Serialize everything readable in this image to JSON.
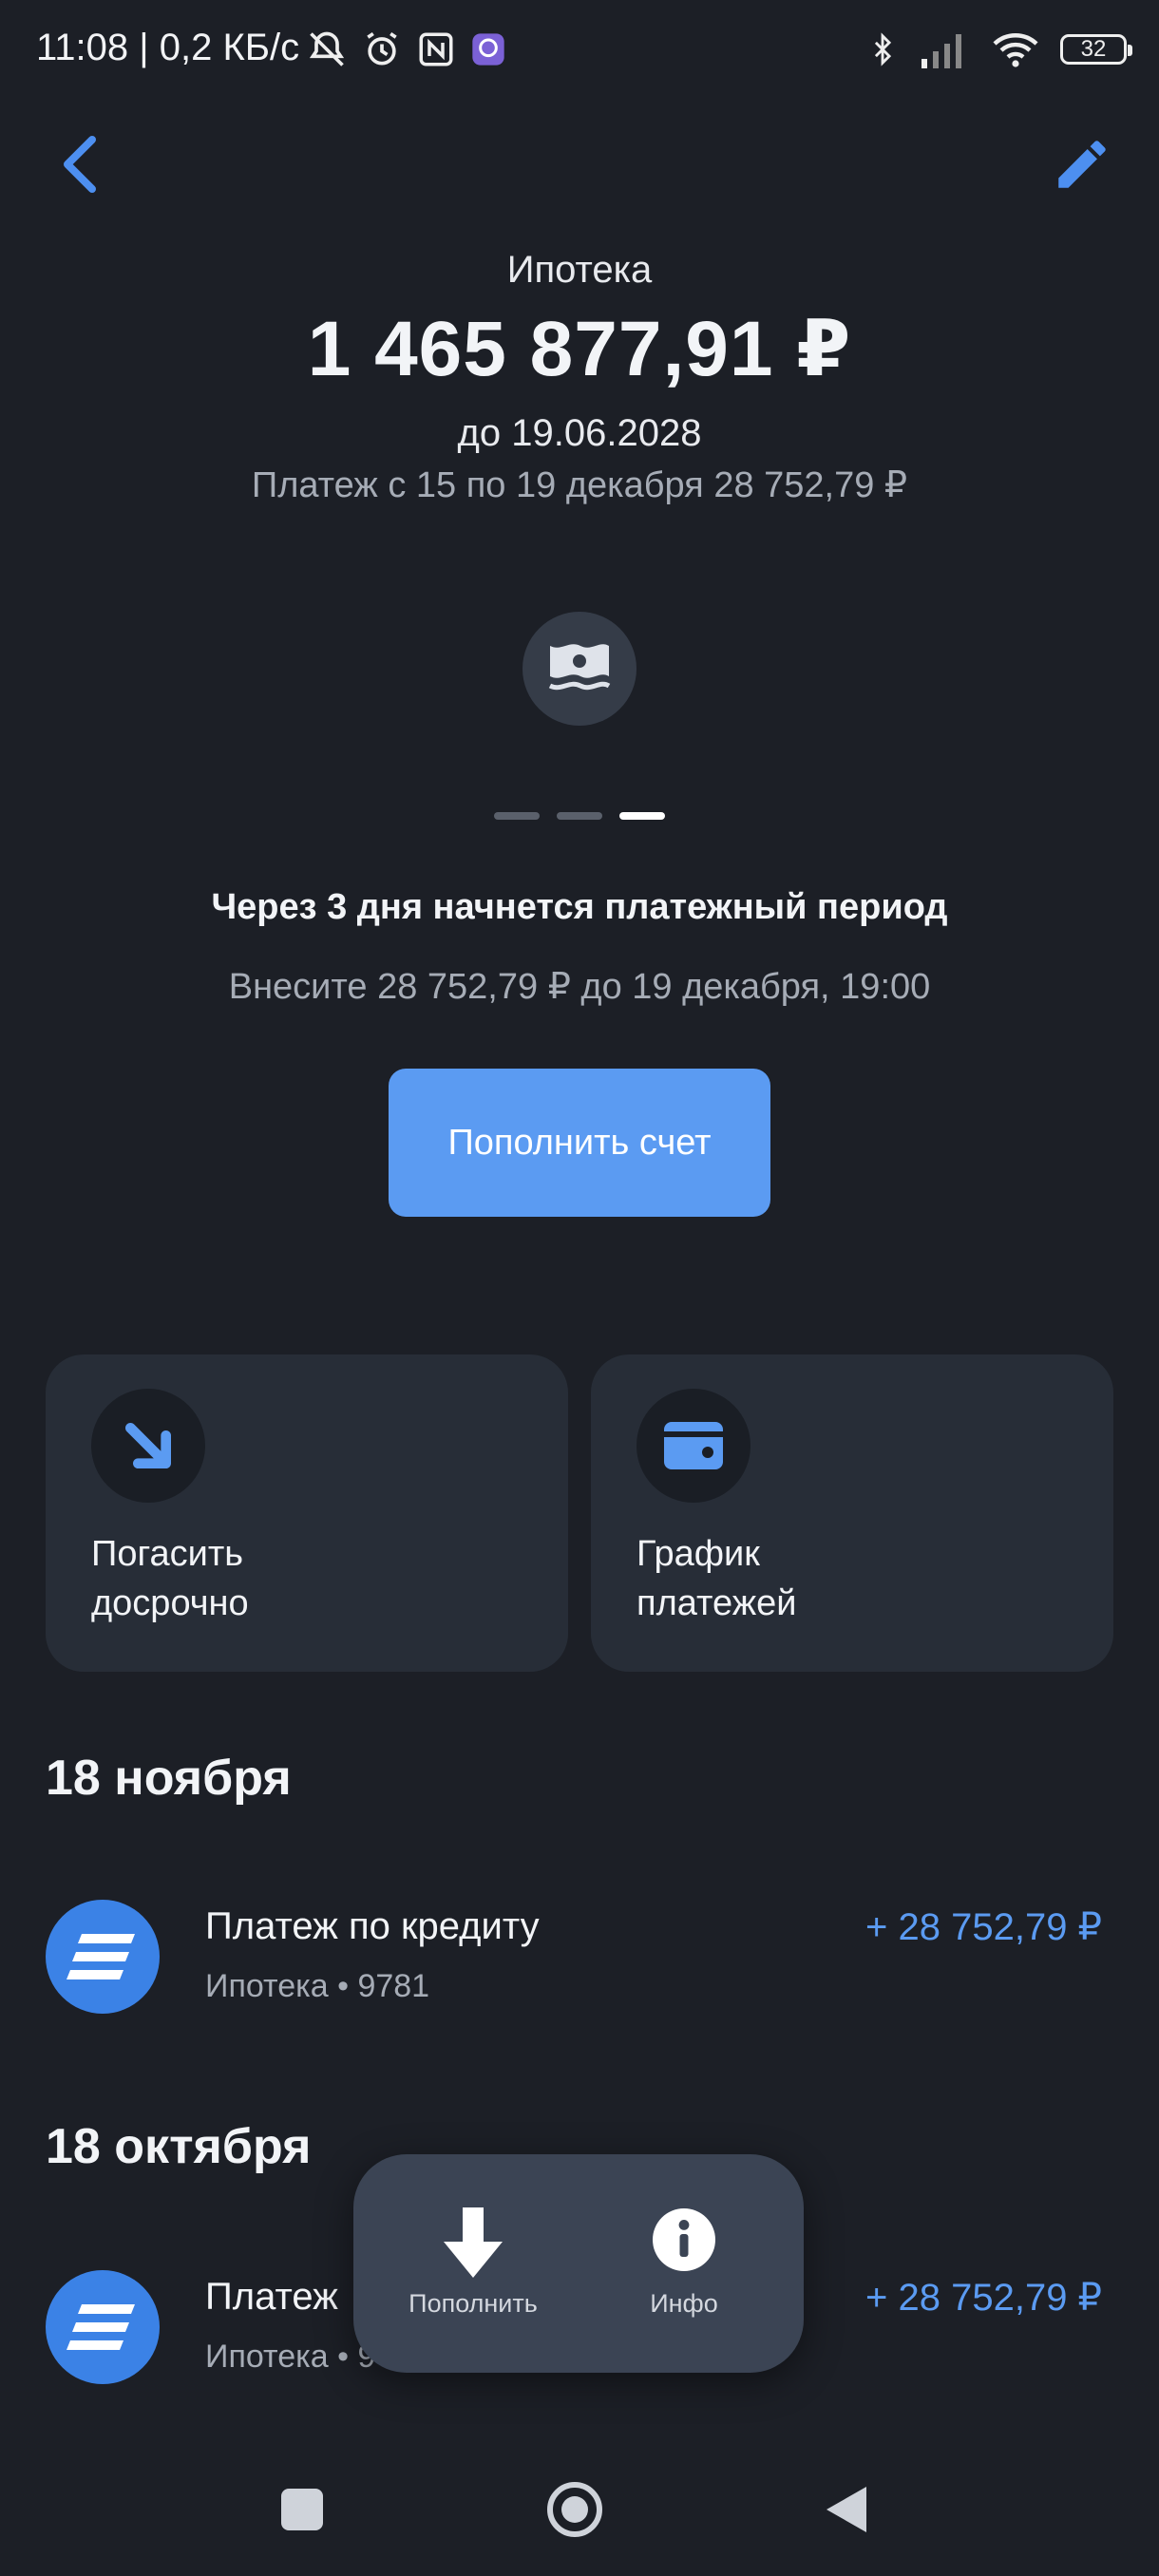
{
  "status_bar": {
    "time_text": "11:08 | 0,2 КБ/с",
    "battery": "32"
  },
  "header": {
    "back_icon": "back-arrow-icon",
    "edit_icon": "pencil-icon"
  },
  "summary": {
    "title": "Ипотека",
    "amount": "1 465 877,91 ₽",
    "until": "до 19.06.2028",
    "payment_line": "Платеж с 15 по 19 декабря 28 752,79 ₽"
  },
  "promo": {
    "icon": "banknote-icon",
    "pages": 3,
    "active_page": 3,
    "title": "Через 3 дня начнется платежный период",
    "subtitle": "Внесите 28 752,79 ₽ до 19 декабря, 19:00",
    "button_label": "Пополнить счет"
  },
  "actions": [
    {
      "line1": "Погасить",
      "line2": "досрочно",
      "icon": "arrow-down-right-icon"
    },
    {
      "line1": "График",
      "line2": "платежей",
      "icon": "wallet-icon"
    }
  ],
  "history": [
    {
      "date": "18 ноября",
      "title": "Платеж по кредиту",
      "subtitle": "Ипотека • 9781",
      "amount": "+ 28 752,79 ₽"
    },
    {
      "date": "18 октября",
      "title": "Платеж",
      "subtitle": "Ипотека • 9",
      "amount": "+ 28 752,79 ₽"
    }
  ],
  "popup_menu": {
    "items": [
      {
        "label": "Пополнить",
        "icon": "download-arrow-icon"
      },
      {
        "label": "Инфо",
        "icon": "info-icon"
      }
    ]
  },
  "colors": {
    "background": "#1c1f26",
    "card": "#272d37",
    "accent": "#5b9bf2",
    "muted_text": "#a6acb6"
  }
}
